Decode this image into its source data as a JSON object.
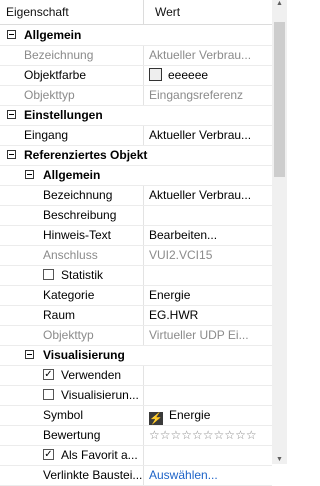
{
  "header": {
    "col_property": "Eigenschaft",
    "col_value": "Wert"
  },
  "rows": [
    {
      "kind": "cat",
      "level": 0,
      "name": "Allgemein"
    },
    {
      "kind": "prop",
      "level": 1,
      "name": "Bezeichnung",
      "value": "Aktueller Verbrau...",
      "disabled": true
    },
    {
      "kind": "prop",
      "level": 1,
      "name": "Objektfarbe",
      "value": "eeeeee",
      "swatch": "#eeeeee"
    },
    {
      "kind": "prop",
      "level": 1,
      "name": "Objekttyp",
      "value": "Eingangsreferenz",
      "disabled": true
    },
    {
      "kind": "cat",
      "level": 0,
      "name": "Einstellungen"
    },
    {
      "kind": "prop",
      "level": 1,
      "name": "Eingang",
      "value": "Aktueller Verbrau..."
    },
    {
      "kind": "cat",
      "level": 0,
      "name": "Referenziertes Objekt"
    },
    {
      "kind": "cat",
      "level": 1,
      "name": "Allgemein"
    },
    {
      "kind": "prop",
      "level": 2,
      "name": "Bezeichnung",
      "value": "Aktueller Verbrau..."
    },
    {
      "kind": "prop",
      "level": 2,
      "name": "Beschreibung",
      "value": ""
    },
    {
      "kind": "prop",
      "level": 2,
      "name": "Hinweis-Text",
      "value": "Bearbeiten..."
    },
    {
      "kind": "prop",
      "level": 2,
      "name": "Anschluss",
      "value": "VUI2.VCI15",
      "disabled": true
    },
    {
      "kind": "check",
      "level": 2,
      "name": "Statistik",
      "checked": false
    },
    {
      "kind": "prop",
      "level": 2,
      "name": "Kategorie",
      "value": "Energie"
    },
    {
      "kind": "prop",
      "level": 2,
      "name": "Raum",
      "value": "EG.HWR"
    },
    {
      "kind": "prop",
      "level": 2,
      "name": "Objekttyp",
      "value": "Virtueller UDP Ei...",
      "disabled": true
    },
    {
      "kind": "cat",
      "level": 1,
      "name": "Visualisierung"
    },
    {
      "kind": "check",
      "level": 2,
      "name": "Verwenden",
      "checked": true
    },
    {
      "kind": "check",
      "level": 2,
      "name": "Visualisierun...",
      "checked": false
    },
    {
      "kind": "prop",
      "level": 2,
      "name": "Symbol",
      "value": "Energie",
      "icon": "lightning-icon"
    },
    {
      "kind": "prop",
      "level": 2,
      "name": "Bewertung",
      "value": "☆☆☆☆☆☆☆☆☆☆",
      "stars": true
    },
    {
      "kind": "check",
      "level": 2,
      "name": "Als Favorit a...",
      "checked": true
    },
    {
      "kind": "prop",
      "level": 2,
      "name": "Verlinkte Baustei...",
      "value": "Auswählen...",
      "link": true
    }
  ]
}
